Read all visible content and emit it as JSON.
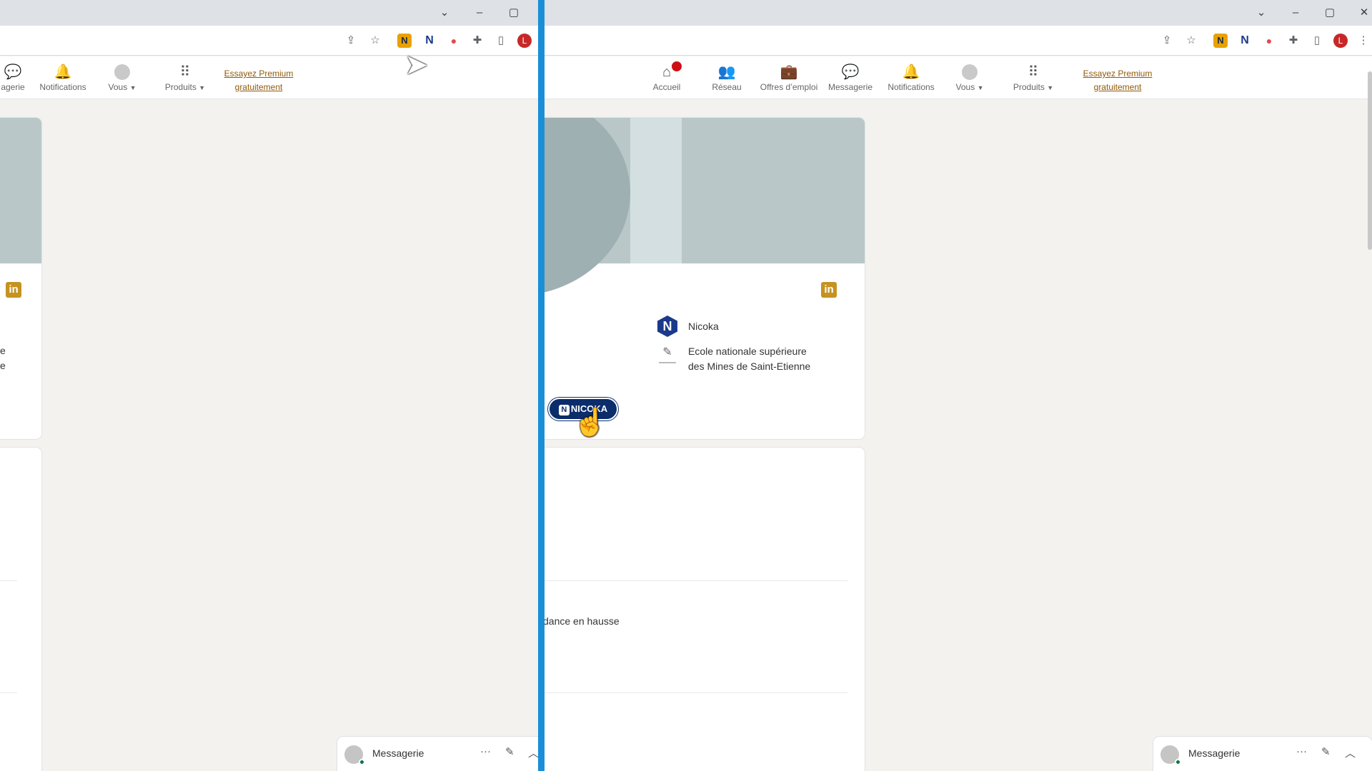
{
  "browser": {
    "window_controls": {
      "tabs_dropdown": "⌄",
      "minimize": "–",
      "maximize": "▢",
      "close": "✕"
    },
    "profile_initial": "L",
    "extensions": [
      "share-icon",
      "star-icon",
      "nicoka-yellow-icon",
      "nicoka-blue-icon",
      "red-extension-icon",
      "puzzle-icon",
      "sidepanel-icon"
    ]
  },
  "nav": {
    "accueil": "Accueil",
    "reseau": "Réseau",
    "offres": "Offres d’emploi",
    "messagerie": "Messagerie",
    "messagerie_cut": "agerie",
    "notifications": "Notifications",
    "vous": "Vous",
    "produits": "Produits",
    "premium_line1": "Essayez Premium",
    "premium_line2": "gratuitement"
  },
  "profile_card": {
    "company": "Nicoka",
    "school_line1": "Ecole nationale supérieure",
    "school_line2": "des Mines de Saint-Etienne",
    "left_frag_1": "e",
    "left_frag_2": "e",
    "nicoka_button": "NICOKA"
  },
  "feed": {
    "trend_text": "dance en hausse"
  },
  "messaging": {
    "label": "Messagerie",
    "more": "···",
    "compose": "✎",
    "collapse": "︿"
  },
  "colors": {
    "divider": "#1a8fd8",
    "premium_link": "#915907",
    "nicoka_button": "#0b2d6b",
    "linkedin_icon": "#c59322",
    "cover": "#b9c7c9"
  }
}
